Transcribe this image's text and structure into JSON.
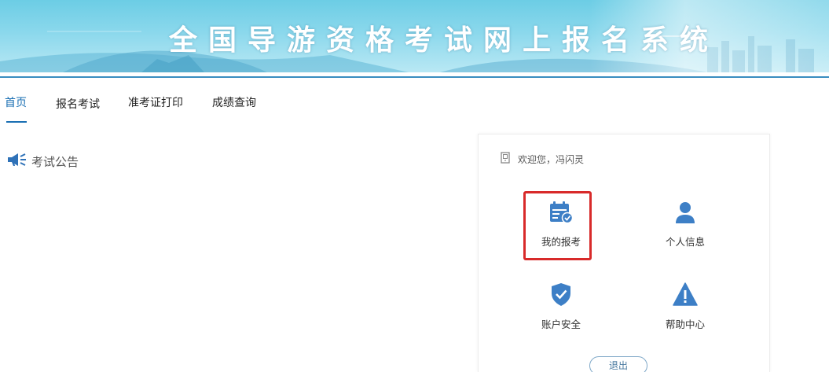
{
  "header": {
    "title": "全国导游资格考试网上报名系统"
  },
  "nav": {
    "items": [
      {
        "label": "首页",
        "active": true
      },
      {
        "label": "报名考试",
        "active": false
      },
      {
        "label": "准考证打印",
        "active": false
      },
      {
        "label": "成绩查询",
        "active": false
      }
    ]
  },
  "notice": {
    "label": "考试公告",
    "icon": "megaphone-icon"
  },
  "user_panel": {
    "welcome": "欢迎您，冯闪灵",
    "welcome_icon": "door-icon",
    "tiles": [
      {
        "label": "我的报考",
        "icon": "calendar-check-icon",
        "highlighted": true
      },
      {
        "label": "个人信息",
        "icon": "user-icon",
        "highlighted": false
      },
      {
        "label": "账户安全",
        "icon": "shield-check-icon",
        "highlighted": false
      },
      {
        "label": "帮助中心",
        "icon": "warning-icon",
        "highlighted": false
      }
    ],
    "logout": "退出"
  },
  "colors": {
    "accent": "#1a6fb3",
    "icon_blue": "#3d7fc6",
    "highlight_red": "#d82a2a",
    "banner": "#79d1e8"
  }
}
